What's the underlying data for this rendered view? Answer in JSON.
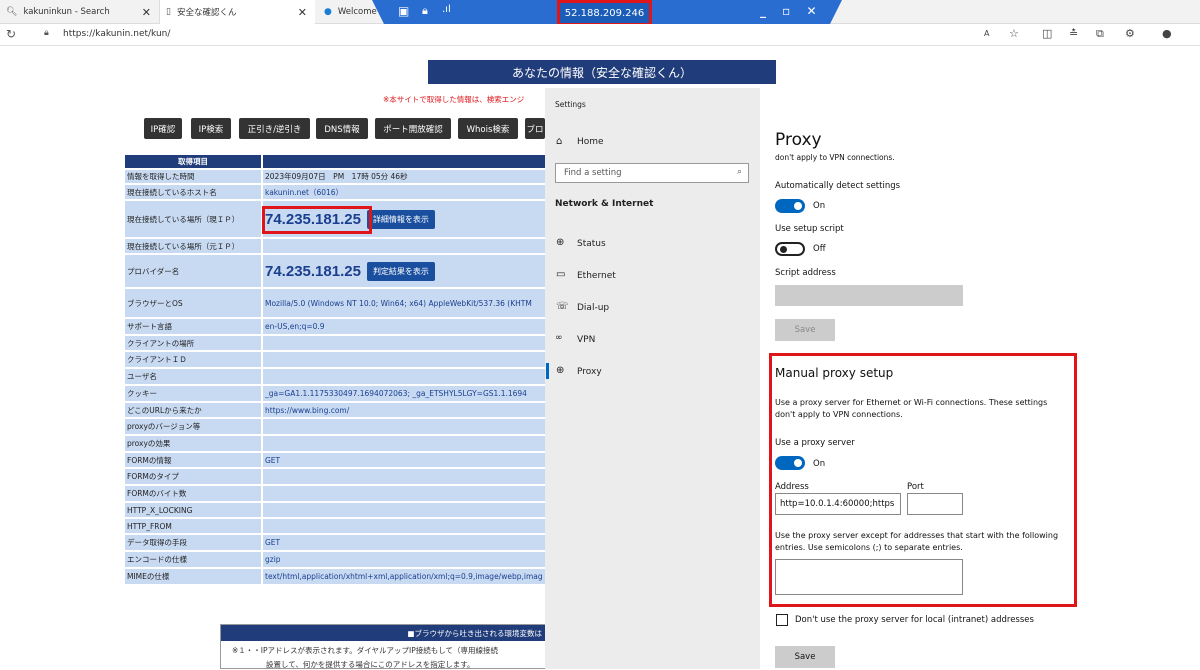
{
  "tabs": [
    {
      "label": "kakuninkun - Search"
    },
    {
      "label": "安全な確認くん"
    },
    {
      "label": "Welcome"
    }
  ],
  "rdp": {
    "ip": "52.188.209.246"
  },
  "address_bar": {
    "url": "https://kakunin.net/kun/"
  },
  "page": {
    "title": "あなたの情報（安全な確認くん）",
    "notice": "※本サイトで取得した情報は、検索エンジ",
    "nav": [
      "IP確認",
      "IP検索",
      "正引き/逆引き",
      "DNS情報",
      "ポート開放確認",
      "Whois検索",
      "ブロ"
    ],
    "table_header": "取得項目",
    "rows": [
      {
        "label": "情報を取得した時間",
        "value": "2023年09月07日　PM　17時 05分 46秒"
      },
      {
        "label": "現在接続しているホスト名",
        "value": "kakunin.net（6016）"
      },
      {
        "label": "現在接続している場所（現ＩＰ）",
        "value": "74.235.181.25",
        "button": "詳細情報を表示"
      },
      {
        "label": "現在接続している場所（元ＩＰ）",
        "value": ""
      },
      {
        "label": "プロバイダー名",
        "value": "74.235.181.25",
        "button": "判定結果を表示"
      },
      {
        "label": "ブラウザーとOS",
        "value": "Mozilla/5.0 (Windows NT 10.0; Win64; x64) AppleWebKit/537.36 (KHTM"
      },
      {
        "label": "サポート言語",
        "value": "en-US,en;q=0.9"
      },
      {
        "label": "クライアントの場所",
        "value": ""
      },
      {
        "label": "クライアントＩＤ",
        "value": ""
      },
      {
        "label": "ユーザ名",
        "value": ""
      },
      {
        "label": "クッキー",
        "value": "_ga=GA1.1.1175330497.1694072063; _ga_ETSHYL5LGY=GS1.1.1694"
      },
      {
        "label": "どこのURLから来たか",
        "value": "https://www.bing.com/"
      },
      {
        "label": "proxyのバージョン等",
        "value": ""
      },
      {
        "label": "proxyの効果",
        "value": ""
      },
      {
        "label": "FORMの情報",
        "value": "GET"
      },
      {
        "label": "FORMのタイプ",
        "value": ""
      },
      {
        "label": "FORMのバイト数",
        "value": ""
      },
      {
        "label": "HTTP_X_LOCKING",
        "value": ""
      },
      {
        "label": "HTTP_FROM",
        "value": ""
      },
      {
        "label": "データ取得の手段",
        "value": "GET"
      },
      {
        "label": "エンコードの仕様",
        "value": "gzip"
      },
      {
        "label": "MIMEの仕様",
        "value": "text/html,application/xhtml+xml,application/xml;q=0.9,image/webp,imag"
      }
    ],
    "env_header": "■ブラウザから吐き出される環境変数は",
    "env_line1": "※１・・IPアドレスが表示されます。ダイヤルアップIP接続もして（専用線接続",
    "env_line2": "設置して、何かを提供する場合にこのアドレスを指定します。"
  },
  "settings": {
    "window_title": "Settings",
    "home": "Home",
    "search_placeholder": "Find a setting",
    "section": "Network & Internet",
    "items": [
      "Status",
      "Ethernet",
      "Dial-up",
      "VPN",
      "Proxy"
    ],
    "main_title": "Proxy",
    "clipped": "don't apply to VPN connections.",
    "auto_detect": "Automatically detect settings",
    "auto_state": "On",
    "setup_script": "Use setup script",
    "setup_state": "Off",
    "script_address": "Script address",
    "save": "Save",
    "manual_title": "Manual proxy setup",
    "manual_desc1": "Use a proxy server for Ethernet or Wi-Fi connections. These settings",
    "manual_desc2": "don't apply to VPN connections.",
    "use_proxy": "Use a proxy server",
    "use_proxy_state": "On",
    "address_label": "Address",
    "port_label": "Port",
    "address_value": "http=10.0.1.4:60000;https",
    "port_value": "",
    "except_desc1": "Use the proxy server except for addresses that start with the following",
    "except_desc2": "entries. Use semicolons (;) to separate entries.",
    "local_checkbox": "Don't use the proxy server for local (intranet) addresses",
    "save2": "Save"
  }
}
